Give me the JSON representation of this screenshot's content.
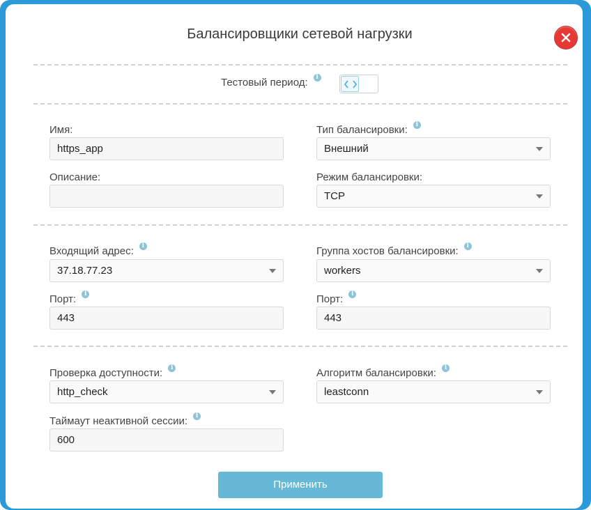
{
  "dialog": {
    "title": "Балансировщики сетевой нагрузки",
    "close_icon": "close-icon"
  },
  "test_period": {
    "label": "Тестовый период:",
    "icon": "code-brackets-icon"
  },
  "form": {
    "name": {
      "label": "Имя:",
      "value": "https_app"
    },
    "description": {
      "label": "Описание:",
      "value": ""
    },
    "balancing_type": {
      "label": "Тип балансировки:",
      "value": "Внешний"
    },
    "balancing_mode": {
      "label": "Режим балансировки:",
      "value": "TCP"
    },
    "incoming_address": {
      "label": "Входящий адрес:",
      "value": "37.18.77.23"
    },
    "incoming_port": {
      "label": "Порт:",
      "value": "443"
    },
    "host_group": {
      "label": "Группа хостов балансировки:",
      "value": "workers"
    },
    "host_port": {
      "label": "Порт:",
      "value": "443"
    },
    "health_check": {
      "label": "Проверка доступности:",
      "value": "http_check"
    },
    "algorithm": {
      "label": "Алгоритм балансировки:",
      "value": "leastconn"
    },
    "idle_timeout": {
      "label": "Таймаут неактивной сессии:",
      "value": "600"
    }
  },
  "actions": {
    "apply_label": "Применить"
  },
  "colors": {
    "accent": "#2a9ad8",
    "apply_button": "#65b9d6",
    "close": "#e53935",
    "info": "#8ec3d8"
  }
}
